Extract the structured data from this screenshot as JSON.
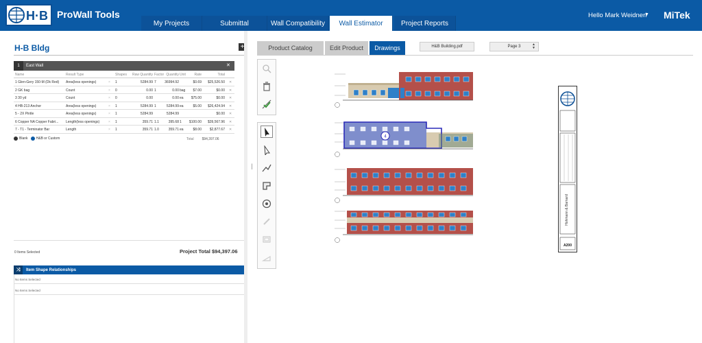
{
  "header": {
    "logo_text": "H·B",
    "app_name": "ProWall Tools",
    "nav": [
      {
        "label": "My Projects",
        "active": false
      },
      {
        "label": "Submittal",
        "active": false
      },
      {
        "label": "Wall Compatibility",
        "active": false
      },
      {
        "label": "Wall Estimator",
        "active": true
      },
      {
        "label": "Project Reports",
        "active": false
      }
    ],
    "greeting": "Hello Mark Weidnerl",
    "brand": "MiTek"
  },
  "project": {
    "title": "H-B Bldg",
    "add_symbol": "+"
  },
  "wall": {
    "number": "1",
    "name": "East Wall",
    "columns": [
      "Name",
      "Result Type",
      "Shapes",
      "Raw Quantity",
      "Factor",
      "Quantity",
      "Unit",
      "Rate",
      "Total"
    ],
    "rows": [
      {
        "name": "1 Glen-Gery 150-M (Dk Red)",
        "result": "Area(less openings)",
        "shapes": "1",
        "raw": "5284.99",
        "factor": "7",
        "qty": "36994.92",
        "unit": "",
        "rate": "$0.69",
        "total": "$25,526.50"
      },
      {
        "name": "2 GK bag",
        "result": "Count",
        "shapes": "0",
        "raw": "0.00",
        "factor": "1",
        "qty": "0.00",
        "unit": "bag",
        "rate": "$7.00",
        "total": "$0.00"
      },
      {
        "name": "3 30 yd",
        "result": "Count",
        "shapes": "0",
        "raw": "0.00",
        "factor": "",
        "qty": "0.00",
        "unit": "ea",
        "rate": "$75.00",
        "total": "$0.00"
      },
      {
        "name": "4 HB-213 Anchor",
        "result": "Area(less openings)",
        "shapes": "1",
        "raw": "5284.99",
        "factor": "1",
        "qty": "5284.99",
        "unit": "ea",
        "rate": "$5.00",
        "total": "$26,424.94"
      },
      {
        "name": "5 - 2X Pintle",
        "result": "Area(less openings)",
        "shapes": "1",
        "raw": "5284.99",
        "factor": "",
        "qty": "5284.99",
        "unit": "",
        "rate": "",
        "total": "$0.00"
      },
      {
        "name": "6 Copper NA Copper Fabri...",
        "result": "Length(less openings)",
        "shapes": "1",
        "raw": "359.71",
        "factor": "1.1",
        "qty": "395.68",
        "unit": "1",
        "rate": "$100.00",
        "total": "$39,567.96"
      },
      {
        "name": "7 - T1 - Terminator Bar",
        "result": "Length",
        "shapes": "1",
        "raw": "359.71",
        "factor": "1.0",
        "qty": "359.71",
        "unit": "ea",
        "rate": "$8.00",
        "total": "$2,877.67"
      }
    ],
    "legend_blank": "Blank",
    "legend_hb": "H&B or Custom",
    "total_label": "Total",
    "total_value": "$94,397.06"
  },
  "summary": {
    "items_selected": "0 Items Selected",
    "project_total": "Project Total $94,397.06"
  },
  "relationships": {
    "title": "Item Shape Relationships",
    "rows": [
      "No Items Selected",
      "No Items Selected"
    ]
  },
  "drawings": {
    "tabs": [
      {
        "label": "Product Catalog",
        "active": false
      },
      {
        "label": "Edit Product",
        "active": false
      },
      {
        "label": "Drawings",
        "active": true
      }
    ],
    "pdf_name": "H&B Building.pdf",
    "page": "Page 3",
    "sheet_number": "A200",
    "firm": "Hohmann & Barnard",
    "marker": "4"
  },
  "colors": {
    "brand_blue": "#0b5aa5",
    "brick": "#b4504a",
    "window": "#2f80c8"
  }
}
